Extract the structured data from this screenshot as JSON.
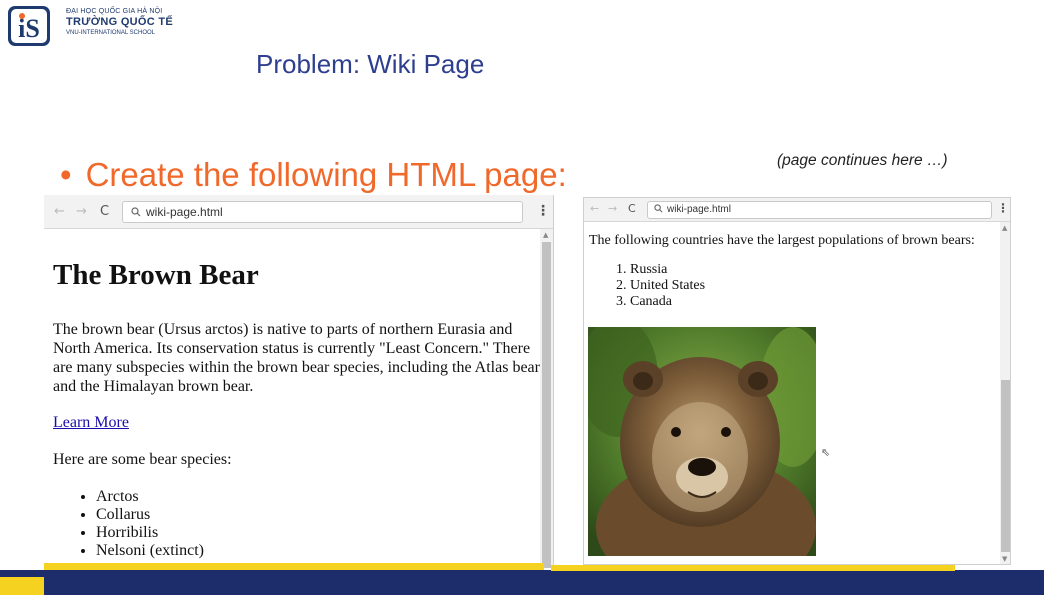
{
  "logo": {
    "line1": "ĐẠI HỌC QUỐC GIA HÀ NỘI",
    "line2": "TRƯỜNG QUỐC TẾ",
    "line3": "VNU-INTERNATIONAL SCHOOL"
  },
  "slide_title": "Problem: Wiki Page",
  "bullet": {
    "marker": "•",
    "text": "Create the following HTML page:"
  },
  "note": "(page continues here …)",
  "browser_left": {
    "url": "wiki-page.html",
    "nav_back": "←",
    "nav_forward": "→",
    "reload": "C",
    "search_glyph": "🔍",
    "menu": "⋮",
    "heading": "The Brown Bear",
    "paragraph": "The brown bear (Ursus arctos) is native to parts of northern Eurasia and North America. Its conservation status is currently \"Least Concern.\" There are many subspecies within the brown bear species, including the Atlas bear and the Himalayan brown bear.",
    "link": "Learn More",
    "species_intro": "Here are some bear species:",
    "species": [
      "Arctos",
      "Collarus",
      "Horribilis",
      "Nelsoni (extinct)"
    ]
  },
  "browser_right": {
    "url": "wiki-page.html",
    "nav_back": "←",
    "nav_forward": "→",
    "reload": "C",
    "menu": "⋮",
    "paragraph": "The following countries have the largest populations of brown bears:",
    "countries": [
      "Russia",
      "United States",
      "Canada"
    ]
  },
  "colors": {
    "title": "#2e3f8f",
    "bullet": "#f0692b",
    "footer": "#1d2d6b",
    "footer_accent": "#f5d21f",
    "link": "#1a0dab"
  }
}
